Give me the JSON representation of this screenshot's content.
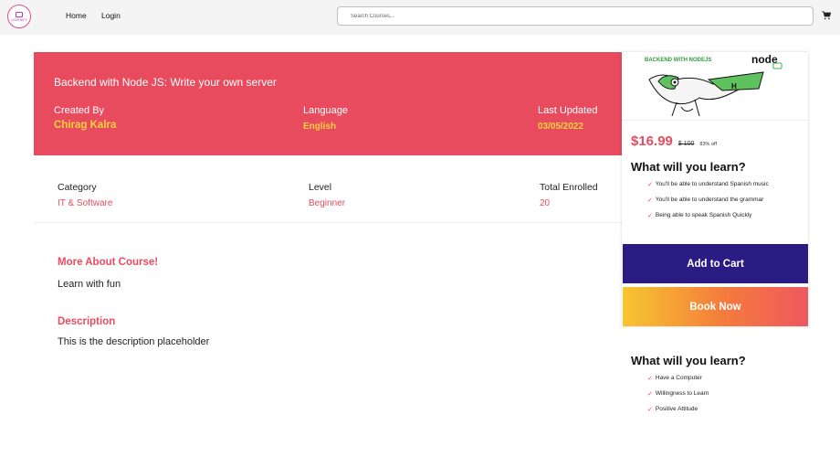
{
  "nav": {
    "logo_text": "LEARNIFY",
    "home": "Home",
    "login": "Login",
    "search_placeholder": "Search Courses..."
  },
  "hero": {
    "title": "Backend with Node JS: Write your own server",
    "created_by_label": "Created By",
    "created_by_value": "Chirag Kalra",
    "language_label": "Language",
    "language_value": "English",
    "updated_label": "Last Updated",
    "updated_value": "03/05/2022"
  },
  "info": {
    "category_label": "Category",
    "category_value": "IT & Software",
    "level_label": "Level",
    "level_value": "Beginner",
    "enrolled_label": "Total Enrolled",
    "enrolled_value": "20"
  },
  "content": {
    "more_title": "More About Course!",
    "more_text": "Learn with fun",
    "desc_title": "Description",
    "desc_text": "This is the description placeholder"
  },
  "card": {
    "thumb_text": "BACKEND WITH NODEJS",
    "thumb_logo": "node",
    "price": "$16.99",
    "old_price": "$ 100",
    "discount": "83% off",
    "learn_title": "What will you learn?",
    "learn_items": [
      "You'll be able to understand Spanish music",
      "You'll be able to understand the grammar",
      "Being able to speak Spanish Quickly"
    ],
    "add_to_cart": "Add to Cart",
    "book_now": "Book Now"
  },
  "requirements": {
    "title": "What will you learn?",
    "items": [
      "Have a Computer",
      "Willingness to Learn",
      "Positive Attitude"
    ]
  },
  "colors": {
    "accent": "#e84b5e",
    "highlight": "#f9d23c",
    "cart_button": "#2b1c83"
  }
}
